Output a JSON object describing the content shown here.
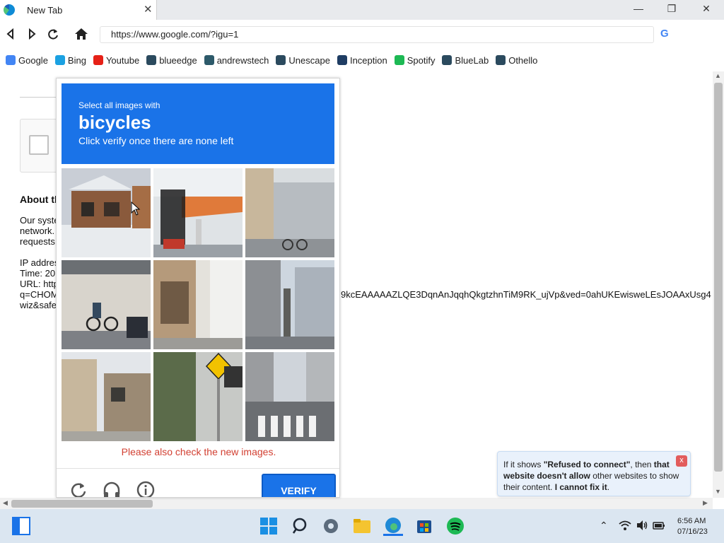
{
  "browser": {
    "tab_title": "New Tab",
    "tab_close": "✕",
    "url": "https://www.google.com/?igu=1",
    "window_controls": {
      "minimize": "—",
      "maximize": "❐",
      "close": "✕"
    }
  },
  "bookmarks": [
    {
      "label": "Google",
      "icon": "google-icon",
      "color": "#4285f4"
    },
    {
      "label": "Bing",
      "icon": "bing-icon",
      "color": "#1ba1e2"
    },
    {
      "label": "Youtube",
      "icon": "youtube-icon",
      "color": "#e62117"
    },
    {
      "label": "blueedge",
      "icon": "blueedge-icon",
      "color": "#2b4a5e"
    },
    {
      "label": "andrewstech",
      "icon": "andrewstech-icon",
      "color": "#2d5a6a"
    },
    {
      "label": "Unescape",
      "icon": "unescape-icon",
      "color": "#2b4a5e"
    },
    {
      "label": "Inception",
      "icon": "inception-icon",
      "color": "#1f3d63"
    },
    {
      "label": "Spotify",
      "icon": "spotify-icon",
      "color": "#1db954"
    },
    {
      "label": "BlueLab",
      "icon": "bluelab-icon",
      "color": "#2b4a5e"
    },
    {
      "label": "Othello",
      "icon": "othello-icon",
      "color": "#2b4a5e"
    }
  ],
  "page": {
    "about_heading": "About th",
    "para1": [
      "Our syste",
      "network.",
      "requests"
    ],
    "ip_lines": [
      "IP addres",
      "Time: 20",
      "URL: http",
      "q=CHOM",
      "wiz&safe"
    ],
    "url_tail": "9kcEAAAAAZLQE3DqnAnJqqhQkgtzhnTiM9RK_ujVp&ved=0ahUKEwisweLEsJOAAxUsg4"
  },
  "captcha": {
    "instruction": "Select all images with",
    "target": "bicycles",
    "sub_instruction": "Click verify once there are none left",
    "notice": "Please also check the new images.",
    "verify_label": "VERIFY",
    "tiles": [
      "house-snow-tile",
      "gas-station-tile",
      "street-bikes-tile",
      "carport-bikes-tile",
      "narrow-alley-tile",
      "building-street-tile",
      "old-houses-tile",
      "road-sign-tile",
      "crosswalk-tile"
    ]
  },
  "tooltip": {
    "t1": "If it shows ",
    "t2": "\"Refused to connect\"",
    "t3": ", then ",
    "t4": "that website doesn't allow",
    "t5": " other websites to show their content. ",
    "t6": "I cannot fix it",
    "t7": ".",
    "close": "x"
  },
  "taskbar": {
    "time": "6:56 AM",
    "date": "07/16/23"
  }
}
